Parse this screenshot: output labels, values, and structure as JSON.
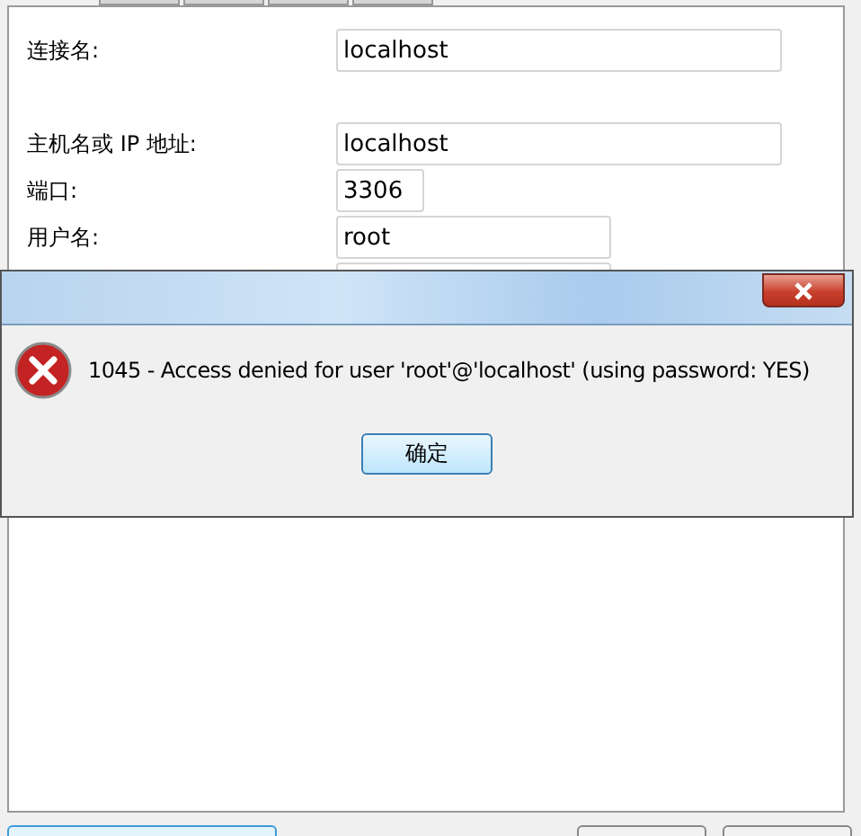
{
  "form": {
    "groups": [
      [
        {
          "label": "连接名:",
          "value": "localhost",
          "kind": "wide"
        }
      ],
      [
        {
          "label": "主机名或 IP 地址:",
          "value": "localhost",
          "kind": "wide"
        },
        {
          "label": "端口:",
          "value": "3306",
          "kind": "short"
        },
        {
          "label": "用户名:",
          "value": "root",
          "kind": "medium"
        }
      ]
    ]
  },
  "error_dialog": {
    "kind": "error",
    "message": "1045 - Access denied for user 'root'@'localhost' (using password: YES)",
    "button": "确定"
  }
}
